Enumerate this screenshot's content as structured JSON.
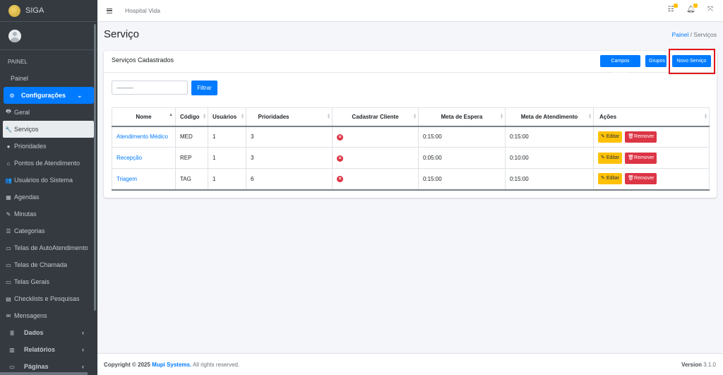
{
  "brand": {
    "name": "SIGA"
  },
  "navbar": {
    "hospital": "Hospital Vida"
  },
  "sidebar": {
    "header": "PAINEL",
    "painel": "Painel",
    "configuracoes": "Configurações",
    "items": [
      {
        "label": "Geral",
        "icon": "print-icon",
        "glyph": "🖶"
      },
      {
        "label": "Serviços",
        "icon": "wrench-icon",
        "glyph": "🔧"
      },
      {
        "label": "Prioridades",
        "icon": "info-circle-icon",
        "glyph": "●"
      },
      {
        "label": "Pontos de Atendimento",
        "icon": "home-icon",
        "glyph": "⌂"
      },
      {
        "label": "Usuários do Sistema",
        "icon": "users-icon",
        "glyph": "👥"
      },
      {
        "label": "Agendas",
        "icon": "calendar-icon",
        "glyph": "▦"
      },
      {
        "label": "Minutas",
        "icon": "edit-icon",
        "glyph": "✎"
      },
      {
        "label": "Categorias",
        "icon": "layers-icon",
        "glyph": "☰"
      },
      {
        "label": "Telas de AutoAtendimento",
        "icon": "monitor-icon",
        "glyph": "▭"
      },
      {
        "label": "Telas de Chamada",
        "icon": "monitor-icon",
        "glyph": "▭"
      },
      {
        "label": "Telas Gerais",
        "icon": "monitor-icon",
        "glyph": "▭"
      },
      {
        "label": "Checklists e Pesquisas",
        "icon": "list-icon",
        "glyph": "▤"
      },
      {
        "label": "Mensagens",
        "icon": "envelope-icon",
        "glyph": "✉"
      }
    ],
    "groups": [
      {
        "label": "Dados",
        "icon": "database-icon",
        "glyph": "≣"
      },
      {
        "label": "Relatórios",
        "icon": "chart-icon",
        "glyph": "▥"
      },
      {
        "label": "Páginas",
        "icon": "desktop-icon",
        "glyph": "▭"
      }
    ]
  },
  "page": {
    "title": "Serviço",
    "crumb_home": "Painel",
    "crumb_sep": "/",
    "crumb_current": "Serviços"
  },
  "card": {
    "title": "Serviços Cadastrados",
    "btn_extras": "Campos Extras",
    "btn_grupos": "Grupos",
    "btn_novo": "Novo Serviço",
    "filter_value": "---------",
    "btn_filtrar": "Filtrar"
  },
  "table": {
    "headers": [
      "Nome",
      "Código",
      "Usuários",
      "Prioridades",
      "Cadastrar Cliente",
      "Meta de Espera",
      "Meta de Atendimento",
      "Ações"
    ],
    "edit_label": "Editar",
    "remove_label": "Remover",
    "rows": [
      {
        "nome": "Atendimento Médico",
        "codigo": "MED",
        "usuarios": "1",
        "prioridades": "3",
        "espera": "0:15:00",
        "atendimento": "0:15:00"
      },
      {
        "nome": "Recepção",
        "codigo": "REP",
        "usuarios": "1",
        "prioridades": "3",
        "espera": "0:05:00",
        "atendimento": "0:10:00"
      },
      {
        "nome": "Triagem",
        "codigo": "TAG",
        "usuarios": "1",
        "prioridades": "6",
        "espera": "0:15:00",
        "atendimento": "0:15:00"
      }
    ]
  },
  "footer": {
    "copyright": "Copyright © 2025",
    "company": "Mupi Systems.",
    "rights": "All rights reserved.",
    "version_label": "Version",
    "version": "3.1.0"
  }
}
